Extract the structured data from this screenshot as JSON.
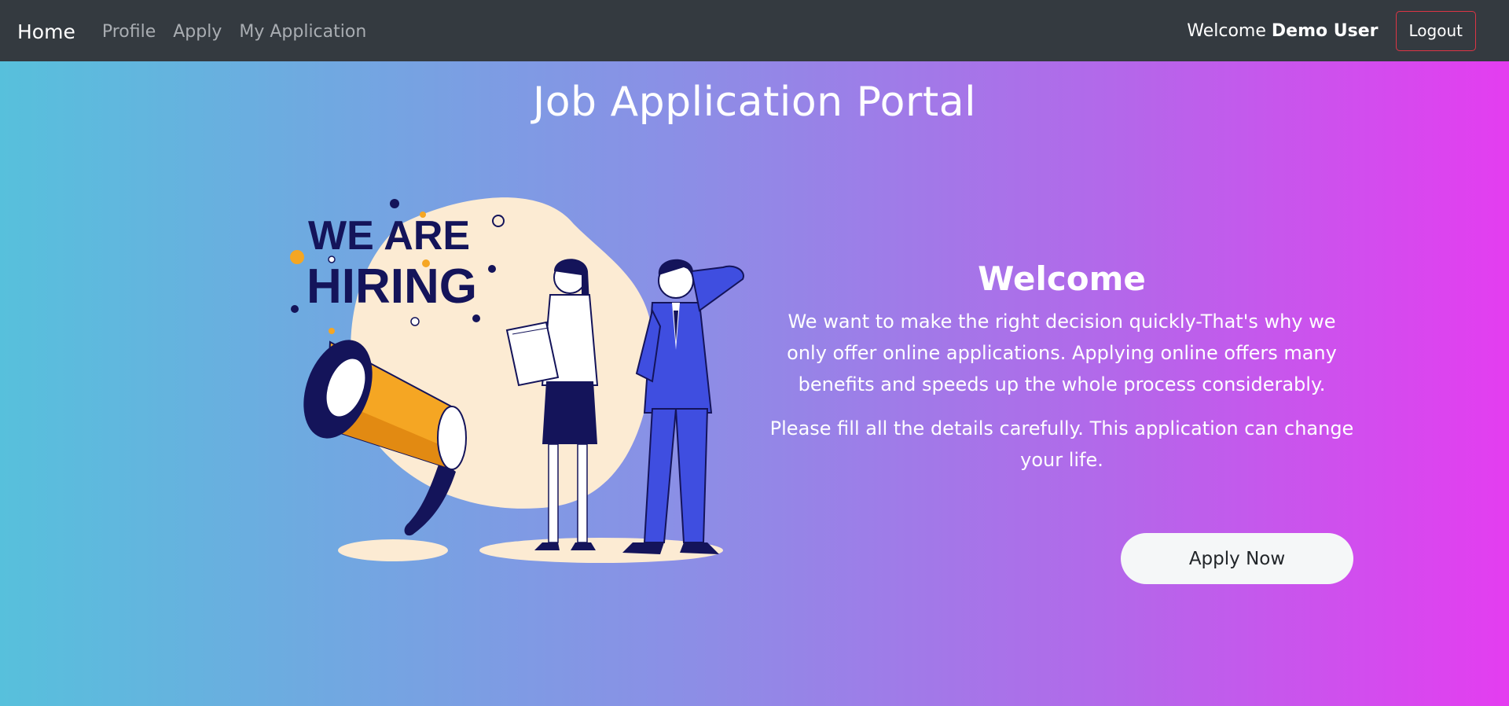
{
  "navbar": {
    "brand": "Home",
    "links": [
      "Profile",
      "Apply",
      "My Application"
    ],
    "welcome_prefix": "Welcome",
    "user_name": "Demo User",
    "logout_label": "Logout"
  },
  "page": {
    "title": "Job Application Portal"
  },
  "illustration": {
    "line1": "WE ARE",
    "line2": "HIRING",
    "colors": {
      "navy": "#14145a",
      "orange": "#f5a623",
      "blob": "#fcebd3",
      "suit": "#3f4ee0"
    }
  },
  "welcome": {
    "heading": "Welcome",
    "paragraph1": "We want to make the right decision quickly-That's why we only offer online applications. Applying online offers many benefits and speeds up the whole process considerably.",
    "paragraph2": "Please fill all the details carefully. This application can change your life."
  },
  "cta": {
    "apply_now_label": "Apply Now"
  },
  "colors": {
    "navbar_bg": "#343a40",
    "gradient_start": "#57c0dc",
    "gradient_end": "#e43df0",
    "logout_border": "#dc3545"
  }
}
